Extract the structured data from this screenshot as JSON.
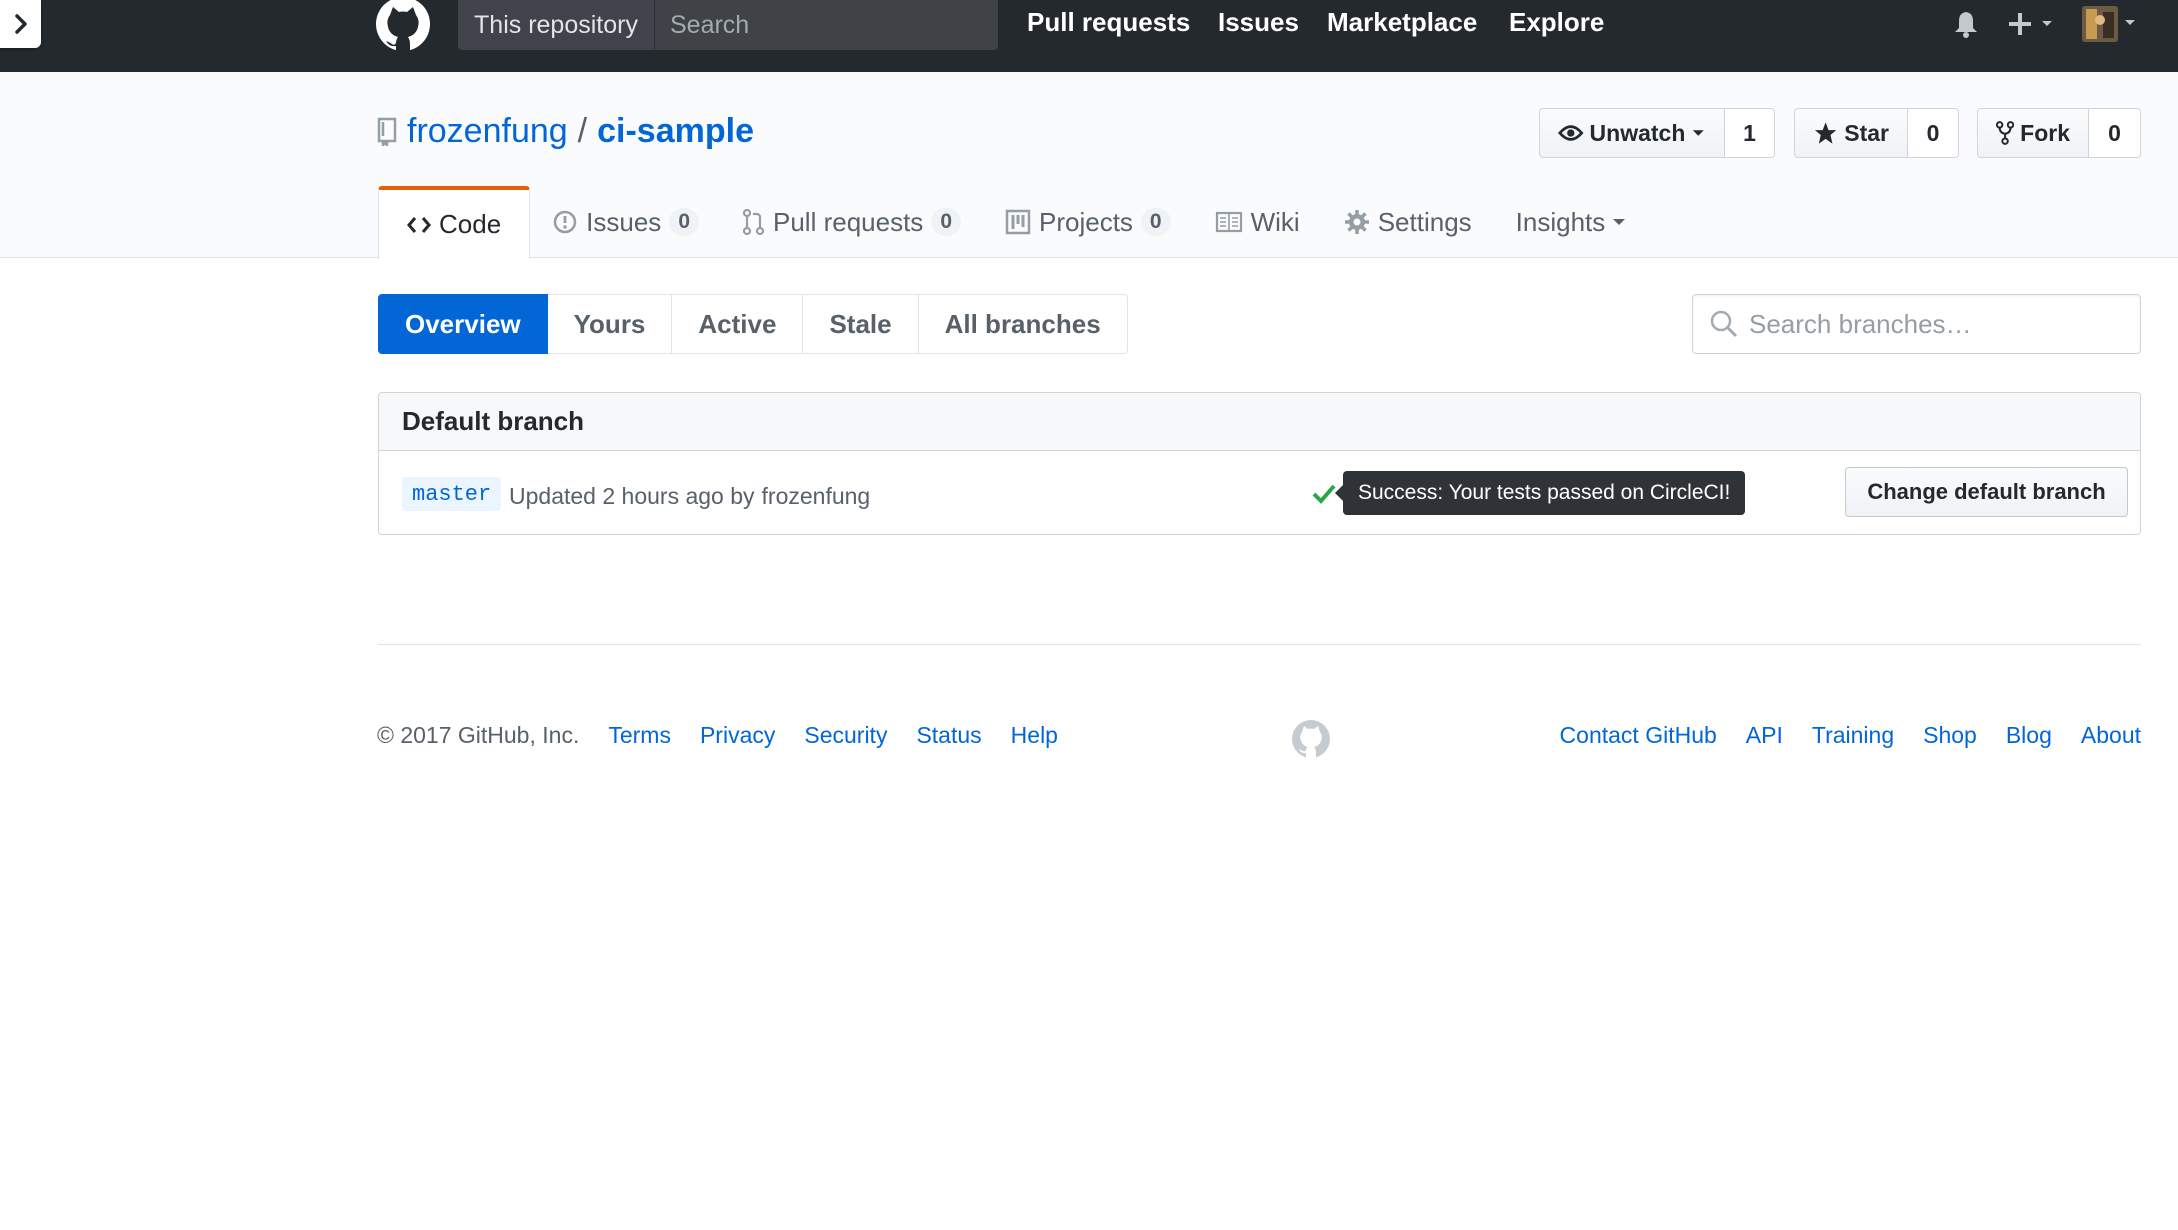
{
  "header": {
    "search_scope": "This repository",
    "search_placeholder": "Search",
    "nav": [
      "Pull requests",
      "Issues",
      "Marketplace",
      "Explore"
    ]
  },
  "repo": {
    "owner": "frozenfung",
    "separator": "/",
    "name": "ci-sample",
    "watch_label": "Unwatch",
    "watch_count": "1",
    "star_label": "Star",
    "star_count": "0",
    "fork_label": "Fork",
    "fork_count": "0"
  },
  "repo_nav": {
    "code": "Code",
    "issues": "Issues",
    "issues_count": "0",
    "pulls": "Pull requests",
    "pulls_count": "0",
    "projects": "Projects",
    "projects_count": "0",
    "wiki": "Wiki",
    "settings": "Settings",
    "insights": "Insights"
  },
  "branch_filters": [
    "Overview",
    "Yours",
    "Active",
    "Stale",
    "All branches"
  ],
  "branch_search_placeholder": "Search branches…",
  "default_branch": {
    "heading": "Default branch",
    "name": "master",
    "updated_text": "Updated 2 hours ago by",
    "author": "frozenfung",
    "status_tooltip": "Success: Your tests passed on CircleCI!",
    "change_button": "Change default branch"
  },
  "footer": {
    "copyright": "© 2017 GitHub, Inc.",
    "left_links": [
      "Terms",
      "Privacy",
      "Security",
      "Status",
      "Help"
    ],
    "right_links": [
      "Contact GitHub",
      "API",
      "Training",
      "Shop",
      "Blog",
      "About"
    ]
  },
  "colors": {
    "header_bg": "#24292e",
    "link": "#0366d6",
    "selected_tab_accent": "#e36209",
    "success": "#28a745"
  }
}
